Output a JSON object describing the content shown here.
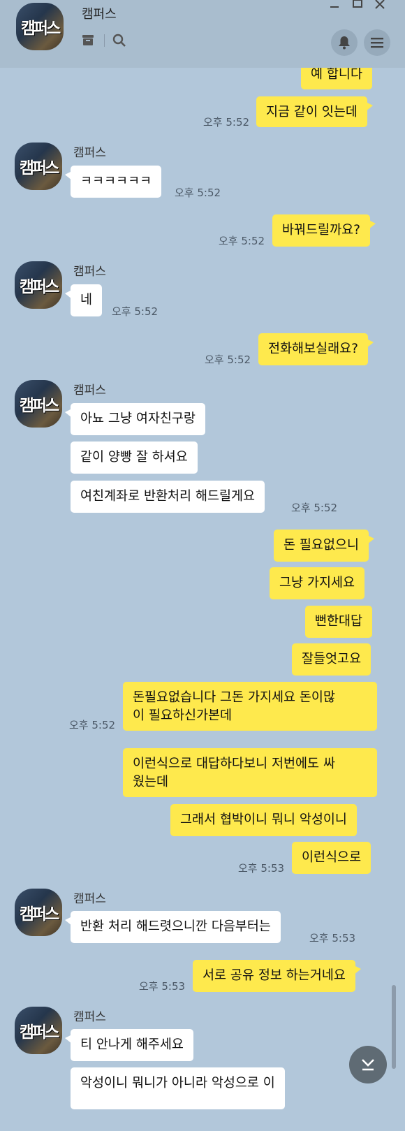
{
  "header": {
    "name": "캠퍼스",
    "avatar_text": "캠퍼스"
  },
  "chat": {
    "sender": "캠퍼스",
    "avatar_text": "캠퍼스",
    "messages": [
      {
        "text": "예 합니다"
      },
      {
        "text": "지금 같이 잇는데",
        "time": "오후 5:52"
      },
      {
        "text": "ㅋㅋㅋㅋㅋㅋ",
        "time": "오후 5:52"
      },
      {
        "text": "바꿔드릴까요?",
        "time": "오후 5:52"
      },
      {
        "text": "네",
        "time": "오후 5:52"
      },
      {
        "text": "전화해보실래요?",
        "time": "오후 5:52"
      },
      {
        "text": "아뇨 그냥 여자친구랑"
      },
      {
        "text": "같이 양빵 잘 하셔요"
      },
      {
        "text": "여친계좌로 반환처리 해드릴게요",
        "time": "오후 5:52"
      },
      {
        "text": "돈 필요없으니"
      },
      {
        "text": "그냥 가지세요"
      },
      {
        "text": "뻔한대답"
      },
      {
        "text": "잘들엇고요"
      },
      {
        "line1": "돈필요없습니다 그돈 가지세요 돈이많",
        "line2": "이 필요하신가본데",
        "time": "오후 5:52"
      },
      {
        "line1": "이런식으로 대답하다보니 저번에도 싸",
        "line2": "웠는데"
      },
      {
        "text": "그래서 협박이니 뭐니 악성이니"
      },
      {
        "text": "이런식으로",
        "time": "오후 5:53"
      },
      {
        "text": "반환 처리 해드렷으니깐 다음부터는",
        "time": "오후 5:53"
      },
      {
        "text": "서로 공유 정보 하는거네요",
        "time": "오후 5:53"
      },
      {
        "text": "티 안나게 해주세요"
      },
      {
        "text": "악성이니 뭐니가 아니라 악성으로 이"
      }
    ]
  }
}
